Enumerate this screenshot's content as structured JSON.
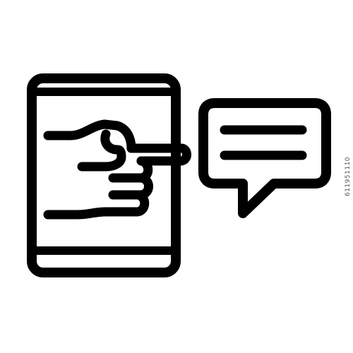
{
  "icon": {
    "name": "tablet-pointing-hand-chat-icon",
    "stroke_color": "#000000",
    "background": "#ffffff"
  },
  "stock_id": "611951110"
}
